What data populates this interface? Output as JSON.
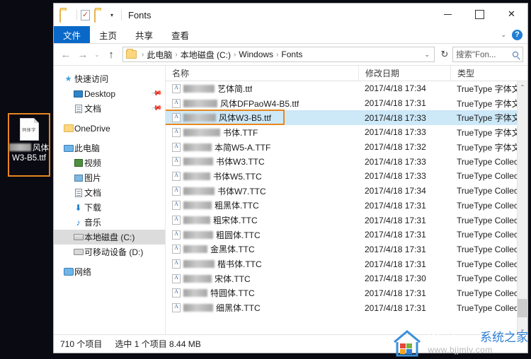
{
  "desktop": {
    "icon": {
      "name": "风体W3-B5.ttf",
      "label_line1_suffix": "风体",
      "label_line2": "W3-B5.ttf",
      "thumb_text": "同体字",
      "highlight_color": "#e8861e"
    }
  },
  "window": {
    "title": "Fonts",
    "quick_access": {
      "folder_icon": "folder-icon",
      "properties_icon": "properties-icon",
      "new_folder_icon": "new-folder-icon",
      "customize_chevron": "▾"
    },
    "controls": {
      "minimize": "—",
      "maximize": "☐",
      "close": "✕"
    }
  },
  "ribbon": {
    "tabs": [
      {
        "label": "文件",
        "active": true
      },
      {
        "label": "主页",
        "active": false
      },
      {
        "label": "共享",
        "active": false
      },
      {
        "label": "查看",
        "active": false
      }
    ],
    "collapse_chevron": "⌄",
    "help_label": "?"
  },
  "addressbar": {
    "back": "←",
    "forward": "→",
    "history": "⌄",
    "up": "↑",
    "breadcrumb": [
      "此电脑",
      "本地磁盘 (C:)",
      "Windows",
      "Fonts"
    ],
    "separator": "›",
    "dropdown": "⌄",
    "refresh": "↻"
  },
  "search": {
    "placeholder": "搜索\"Fon...",
    "icon": "search-icon"
  },
  "sidebar": {
    "items": [
      {
        "label": "快速访问",
        "icon": "star-icon",
        "level": 0,
        "pinned": false,
        "selected": false
      },
      {
        "label": "Desktop",
        "icon": "desktop-icon",
        "level": 1,
        "pinned": true,
        "selected": false
      },
      {
        "label": "文档",
        "icon": "document-icon",
        "level": 1,
        "pinned": true,
        "selected": false
      },
      {
        "label": "OneDrive",
        "icon": "onedrive-icon",
        "level": 0,
        "pinned": false,
        "selected": false
      },
      {
        "label": "此电脑",
        "icon": "computer-icon",
        "level": 0,
        "pinned": false,
        "selected": false
      },
      {
        "label": "视频",
        "icon": "video-icon",
        "level": 1,
        "pinned": false,
        "selected": false
      },
      {
        "label": "图片",
        "icon": "pictures-icon",
        "level": 1,
        "pinned": false,
        "selected": false
      },
      {
        "label": "文档",
        "icon": "document-icon",
        "level": 1,
        "pinned": false,
        "selected": false
      },
      {
        "label": "下载",
        "icon": "download-icon",
        "level": 1,
        "pinned": false,
        "selected": false
      },
      {
        "label": "音乐",
        "icon": "music-icon",
        "level": 1,
        "pinned": false,
        "selected": false
      },
      {
        "label": "本地磁盘 (C:)",
        "icon": "harddrive-icon",
        "level": 1,
        "pinned": false,
        "selected": true
      },
      {
        "label": "可移动设备 (D:)",
        "icon": "removabledrive-icon",
        "level": 1,
        "pinned": false,
        "selected": false
      },
      {
        "label": "网络",
        "icon": "network-icon",
        "level": 0,
        "pinned": false,
        "selected": false
      }
    ]
  },
  "filelist": {
    "columns": [
      {
        "key": "name",
        "label": "名称"
      },
      {
        "key": "date",
        "label": "修改日期"
      },
      {
        "key": "type",
        "label": "类型"
      }
    ],
    "sort_indicator": "⌃",
    "rows": [
      {
        "name": "艺体简.ttf",
        "date": "2017/4/18 17:34",
        "type": "TrueType 字体文",
        "redact": 44,
        "selected": false
      },
      {
        "name": "风体DFPaoW4-B5.ttf",
        "date": "2017/4/18 17:31",
        "type": "TrueType 字体文",
        "redact": 48,
        "selected": false
      },
      {
        "name": "风体W3-B5.ttf",
        "date": "2017/4/18 17:33",
        "type": "TrueType 字体文",
        "redact": 46,
        "selected": true
      },
      {
        "name": "书体.TTF",
        "date": "2017/4/18 17:33",
        "type": "TrueType 字体文",
        "redact": 52,
        "selected": false
      },
      {
        "name": "本简W5-A.TTF",
        "date": "2017/4/18 17:32",
        "type": "TrueType 字体文",
        "redact": 40,
        "selected": false
      },
      {
        "name": "书体W3.TTC",
        "date": "2017/4/18 17:33",
        "type": "TrueType Collect",
        "redact": 42,
        "selected": false
      },
      {
        "name": "书体W5.TTC",
        "date": "2017/4/18 17:33",
        "type": "TrueType Collect",
        "redact": 38,
        "selected": false
      },
      {
        "name": "书体W7.TTC",
        "date": "2017/4/18 17:34",
        "type": "TrueType Collect",
        "redact": 44,
        "selected": false
      },
      {
        "name": "粗黑体.TTC",
        "date": "2017/4/18 17:31",
        "type": "TrueType Collect",
        "redact": 40,
        "selected": false
      },
      {
        "name": "粗宋体.TTC",
        "date": "2017/4/18 17:31",
        "type": "TrueType Collect",
        "redact": 38,
        "selected": false
      },
      {
        "name": "粗圆体.TTC",
        "date": "2017/4/18 17:31",
        "type": "TrueType Collect",
        "redact": 42,
        "selected": false
      },
      {
        "name": "金黑体.TTC",
        "date": "2017/4/18 17:31",
        "type": "TrueType Collect",
        "redact": 34,
        "selected": false
      },
      {
        "name": "楷书体.TTC",
        "date": "2017/4/18 17:31",
        "type": "TrueType Collect",
        "redact": 44,
        "selected": false
      },
      {
        "name": "宋体.TTC",
        "date": "2017/4/18 17:30",
        "type": "TrueType Collect",
        "redact": 40,
        "selected": false
      },
      {
        "name": "特圆体.TTC",
        "date": "2017/4/18 17:31",
        "type": "TrueType Collect",
        "redact": 34,
        "selected": false
      },
      {
        "name": "细黑体.TTC",
        "date": "2017/4/18 17:31",
        "type": "TrueType Collect",
        "redact": 42,
        "selected": false
      }
    ],
    "selection_box_color": "#e8861e",
    "selection_row_color": "#cde8f7"
  },
  "scrollbar": {
    "up": "⌃",
    "down": "⌄"
  },
  "statusbar": {
    "item_count": "710 个项目",
    "selection_info": "选中 1 个项目  8.44 MB"
  },
  "watermark": {
    "line1_en": "Windows ",
    "line1_cn": "系统之家",
    "line2": "www.bjjmlv.com"
  }
}
